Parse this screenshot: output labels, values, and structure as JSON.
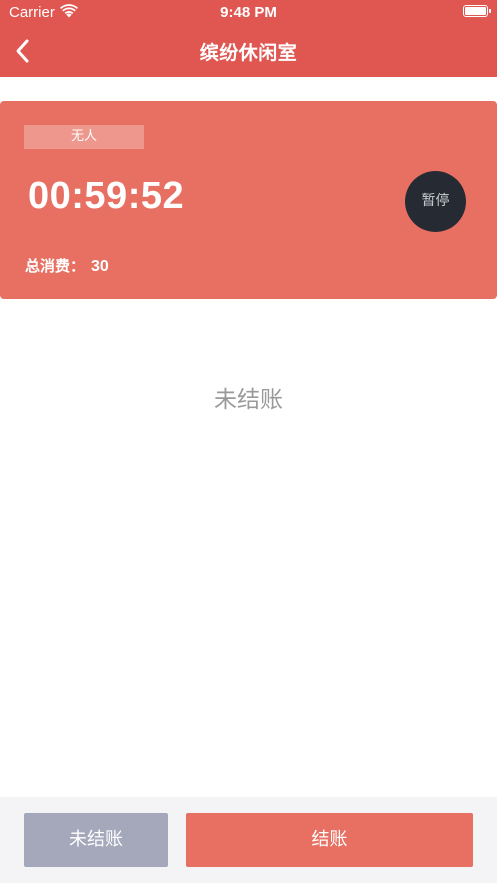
{
  "status_bar": {
    "carrier": "Carrier",
    "time": "9:48 PM",
    "icons": [
      "wifi-icon",
      "battery-icon"
    ]
  },
  "nav": {
    "title": "缤纷休闲室",
    "back_icon": "chevron-left-icon"
  },
  "room_card": {
    "status_badge": "无人",
    "timer": "00:59:52",
    "pause_label": "暂停",
    "total_label": "总消费：",
    "total_value": "30"
  },
  "main": {
    "empty_text": "未结账"
  },
  "bottom_bar": {
    "unpaid_label": "未结账",
    "checkout_label": "结账"
  },
  "colors": {
    "header": "#e05752",
    "card": "#e77062",
    "pause_button": "#252a33",
    "unpaid_button": "#a5a7ba",
    "checkout_button": "#e77062"
  }
}
